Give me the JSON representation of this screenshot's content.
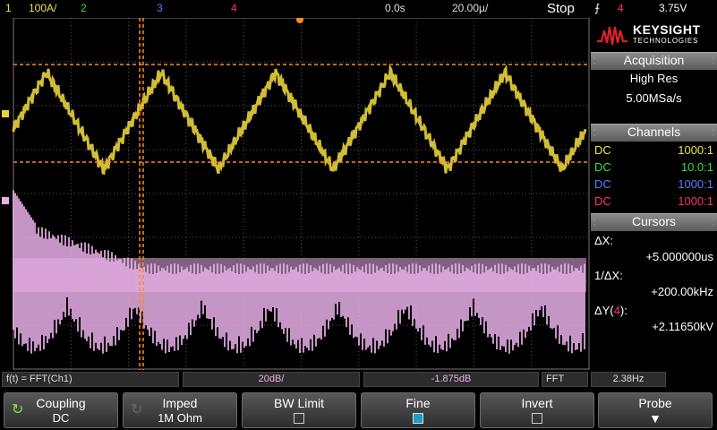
{
  "topbar": {
    "ch1_scale": "100A/",
    "ch2_label": "2",
    "ch3_label": "3",
    "ch4_label": "4",
    "delay": "0.0s",
    "timebase": "20.00µ/",
    "run_state": "Stop",
    "trigger_channel": "4",
    "trigger_level": "3.75V"
  },
  "brand": {
    "name": "KEYSIGHT",
    "sub": "TECHNOLOGIES"
  },
  "acquisition": {
    "title": "Acquisition",
    "mode": "High Res",
    "rate": "5.00MSa/s"
  },
  "channels": {
    "title": "Channels",
    "rows": [
      {
        "coupling": "DC",
        "probe": "1000:1",
        "color": "#f0e44a"
      },
      {
        "coupling": "DC",
        "probe": "10.0:1",
        "color": "#3fdc3f"
      },
      {
        "coupling": "DC",
        "probe": "1000:1",
        "color": "#5b7cff"
      },
      {
        "coupling": "DC",
        "probe": "1000:1",
        "color": "#ff2d7a"
      }
    ]
  },
  "cursors": {
    "title": "Cursors",
    "dx_label": "ΔX:",
    "dx_value": "+5.000000us",
    "inv_dx_label": "1/ΔX:",
    "inv_dx_value": "+200.00kHz",
    "dy_label_prefix": "ΔY(",
    "dy_channel": "4",
    "dy_label_suffix": "):",
    "dy_value": "+2.11650kV"
  },
  "readouts": {
    "math": "f(t) = FFT(Ch1)",
    "scale": "20dB/",
    "offset": "-1.875dB",
    "fft_label": "FFT",
    "resolution": "2.38Hz"
  },
  "softkeys": [
    {
      "top": "Coupling",
      "bottom": "DC"
    },
    {
      "top": "Imped",
      "bottom": "1M Ohm"
    },
    {
      "top": "BW Limit",
      "bottom": ""
    },
    {
      "top": "Fine",
      "bottom": ""
    },
    {
      "top": "Invert",
      "bottom": ""
    },
    {
      "top": "Probe",
      "bottom": ""
    }
  ],
  "colors": {
    "ch1": "#e8d23c",
    "fft": "#e8b0e8",
    "cursor": "#ff8c1a",
    "grid": "#5a5a5a"
  }
}
